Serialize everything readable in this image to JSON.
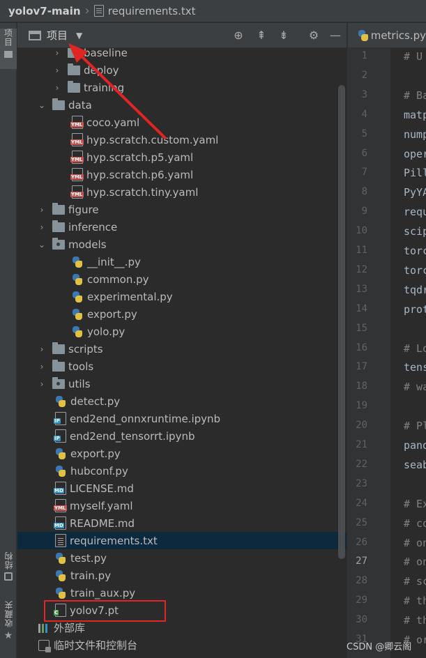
{
  "breadcrumb": {
    "project": "yolov7-main",
    "file": "requirements.txt"
  },
  "stripe": {
    "project_tab": "项目",
    "structure_tab": "结构",
    "favorites_tab": "收藏夹"
  },
  "project_panel": {
    "title": "项目"
  },
  "tree": [
    {
      "label": "baseline",
      "type": "folder",
      "depth": 2
    },
    {
      "label": "deploy",
      "type": "folder",
      "depth": 2
    },
    {
      "label": "training",
      "type": "folder",
      "depth": 2
    },
    {
      "label": "data",
      "type": "folder-open",
      "depth": 1
    },
    {
      "label": "coco.yaml",
      "type": "yml",
      "depth": 2
    },
    {
      "label": "hyp.scratch.custom.yaml",
      "type": "yml",
      "depth": 2
    },
    {
      "label": "hyp.scratch.p5.yaml",
      "type": "yml",
      "depth": 2
    },
    {
      "label": "hyp.scratch.p6.yaml",
      "type": "yml",
      "depth": 2
    },
    {
      "label": "hyp.scratch.tiny.yaml",
      "type": "yml",
      "depth": 2
    },
    {
      "label": "figure",
      "type": "folder",
      "depth": 1
    },
    {
      "label": "inference",
      "type": "folder",
      "depth": 1
    },
    {
      "label": "models",
      "type": "package-open",
      "depth": 1
    },
    {
      "label": "__init__.py",
      "type": "py",
      "depth": 2
    },
    {
      "label": "common.py",
      "type": "py",
      "depth": 2
    },
    {
      "label": "experimental.py",
      "type": "py",
      "depth": 2
    },
    {
      "label": "export.py",
      "type": "py",
      "depth": 2
    },
    {
      "label": "yolo.py",
      "type": "py",
      "depth": 2
    },
    {
      "label": "scripts",
      "type": "folder",
      "depth": 1
    },
    {
      "label": "tools",
      "type": "folder",
      "depth": 1
    },
    {
      "label": "utils",
      "type": "package",
      "depth": 1
    },
    {
      "label": "detect.py",
      "type": "py",
      "depth": 1
    },
    {
      "label": "end2end_onnxruntime.ipynb",
      "type": "ip",
      "depth": 1
    },
    {
      "label": "end2end_tensorrt.ipynb",
      "type": "ip",
      "depth": 1
    },
    {
      "label": "export.py",
      "type": "py",
      "depth": 1
    },
    {
      "label": "hubconf.py",
      "type": "py",
      "depth": 1
    },
    {
      "label": "LICENSE.md",
      "type": "md",
      "depth": 1
    },
    {
      "label": "myself.yaml",
      "type": "yml",
      "depth": 1
    },
    {
      "label": "README.md",
      "type": "md",
      "depth": 1
    },
    {
      "label": "requirements.txt",
      "type": "txt",
      "depth": 1,
      "selected": true
    },
    {
      "label": "test.py",
      "type": "py",
      "depth": 1
    },
    {
      "label": "train.py",
      "type": "py",
      "depth": 1
    },
    {
      "label": "train_aux.py",
      "type": "py",
      "depth": 1
    },
    {
      "label": "yolov7.pt",
      "type": "pt",
      "depth": 1
    },
    {
      "label": "外部库",
      "type": "lib",
      "depth": 0
    },
    {
      "label": "临时文件和控制台",
      "type": "scratch",
      "depth": 0
    }
  ],
  "editor": {
    "tab_label": "metrics.py",
    "current_line": 27,
    "lines": [
      {
        "n": 1,
        "text": "# U",
        "comment": true
      },
      {
        "n": 2,
        "text": "",
        "comment": false
      },
      {
        "n": 3,
        "text": "# Ba",
        "comment": true
      },
      {
        "n": 4,
        "text": "matp",
        "comment": false
      },
      {
        "n": 5,
        "text": "nump",
        "comment": false
      },
      {
        "n": 6,
        "text": "oper",
        "comment": false
      },
      {
        "n": 7,
        "text": "Pill",
        "comment": false
      },
      {
        "n": 8,
        "text": "PyYA",
        "comment": false
      },
      {
        "n": 9,
        "text": "requ",
        "comment": false
      },
      {
        "n": 10,
        "text": "scip",
        "comment": false
      },
      {
        "n": 11,
        "text": "torc",
        "comment": false
      },
      {
        "n": 12,
        "text": "torc",
        "comment": false
      },
      {
        "n": 13,
        "text": "tqdr",
        "comment": false
      },
      {
        "n": 14,
        "text": "prot",
        "comment": false
      },
      {
        "n": 15,
        "text": "",
        "comment": false
      },
      {
        "n": 16,
        "text": "# Lo",
        "comment": true
      },
      {
        "n": 17,
        "text": "tens",
        "comment": false
      },
      {
        "n": 18,
        "text": "# wa",
        "comment": true
      },
      {
        "n": 19,
        "text": "",
        "comment": false
      },
      {
        "n": 20,
        "text": "# Pl",
        "comment": true
      },
      {
        "n": 21,
        "text": "pand",
        "comment": false
      },
      {
        "n": 22,
        "text": "seab",
        "comment": false
      },
      {
        "n": 23,
        "text": "",
        "comment": false
      },
      {
        "n": 24,
        "text": "# Ex",
        "comment": true
      },
      {
        "n": 25,
        "text": "# co",
        "comment": true
      },
      {
        "n": 26,
        "text": "# on",
        "comment": true
      },
      {
        "n": 27,
        "text": "# on",
        "comment": true
      },
      {
        "n": 28,
        "text": "# sc",
        "comment": true
      },
      {
        "n": 29,
        "text": "# th",
        "comment": true
      },
      {
        "n": 30,
        "text": "# th",
        "comment": true
      },
      {
        "n": 31,
        "text": "# or",
        "comment": true
      }
    ]
  },
  "watermark": "CSDN @卿云阁",
  "colors": {
    "annotation": "#e02525",
    "selection": "#0d293e"
  }
}
